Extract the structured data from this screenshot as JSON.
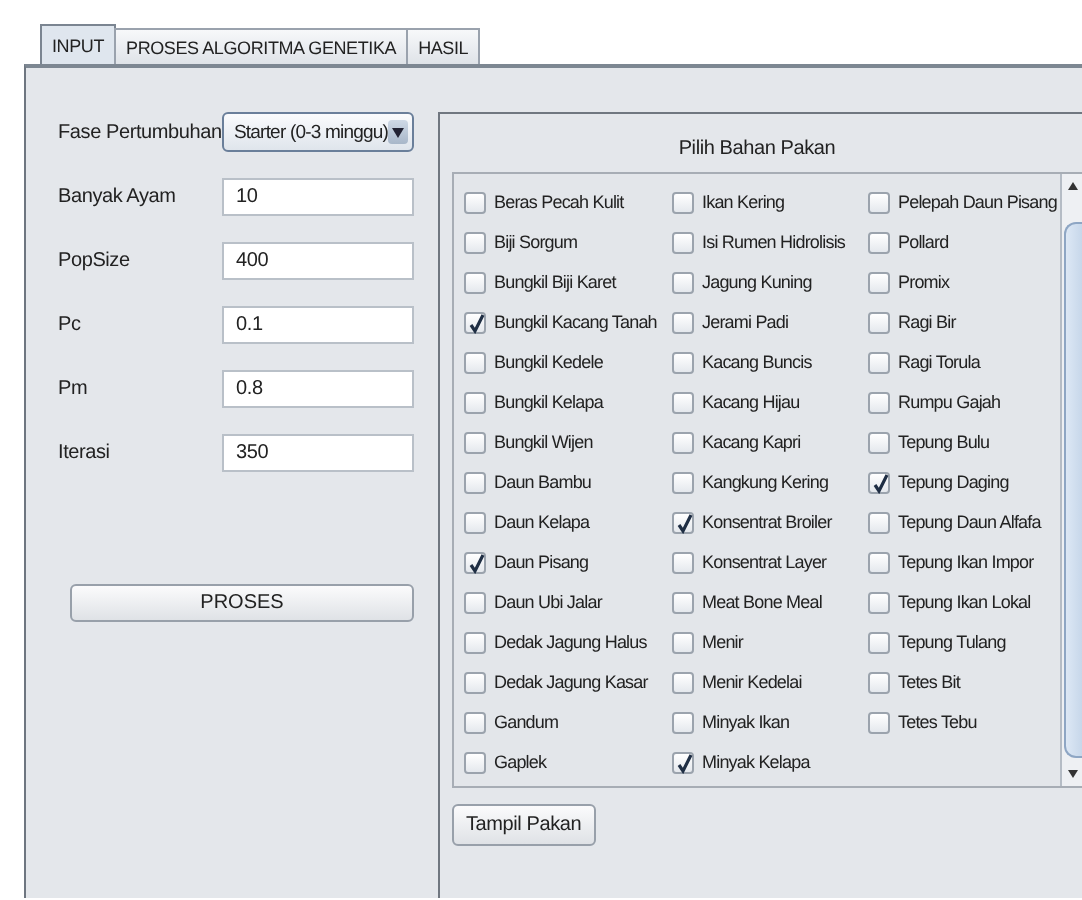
{
  "tabs": [
    {
      "label": "INPUT",
      "selected": true
    },
    {
      "label": "PROSES ALGORITMA GENETIKA",
      "selected": false
    },
    {
      "label": "HASIL",
      "selected": false
    }
  ],
  "form": {
    "fields": [
      {
        "kind": "combo",
        "label": "Fase Pertumbuhan",
        "value": "Starter  (0-3 minggu)"
      },
      {
        "kind": "text",
        "label": "Banyak Ayam",
        "value": "10"
      },
      {
        "kind": "text",
        "label": "PopSize",
        "value": "400"
      },
      {
        "kind": "text",
        "label": "Pc",
        "value": "0.1"
      },
      {
        "kind": "text",
        "label": "Pm",
        "value": "0.8"
      },
      {
        "kind": "text",
        "label": "Iterasi",
        "value": "350"
      }
    ],
    "button": "PROSES"
  },
  "feed": {
    "title": "Pilih Bahan Pakan",
    "columns": [
      [
        {
          "label": "Beras Pecah Kulit",
          "checked": false
        },
        {
          "label": "Biji Sorgum",
          "checked": false
        },
        {
          "label": "Bungkil Biji Karet",
          "checked": false
        },
        {
          "label": "Bungkil Kacang Tanah",
          "checked": true
        },
        {
          "label": "Bungkil Kedele",
          "checked": false
        },
        {
          "label": "Bungkil Kelapa",
          "checked": false
        },
        {
          "label": "Bungkil Wijen",
          "checked": false
        },
        {
          "label": "Daun Bambu",
          "checked": false
        },
        {
          "label": "Daun Kelapa",
          "checked": false
        },
        {
          "label": "Daun Pisang",
          "checked": true
        },
        {
          "label": "Daun Ubi Jalar",
          "checked": false
        },
        {
          "label": "Dedak Jagung Halus",
          "checked": false
        },
        {
          "label": "Dedak Jagung Kasar",
          "checked": false
        },
        {
          "label": "Gandum",
          "checked": false
        },
        {
          "label": "Gaplek",
          "checked": false
        }
      ],
      [
        {
          "label": "Ikan Kering",
          "checked": false
        },
        {
          "label": "Isi Rumen Hidrolisis",
          "checked": false
        },
        {
          "label": "Jagung Kuning",
          "checked": false
        },
        {
          "label": "Jerami Padi",
          "checked": false
        },
        {
          "label": "Kacang Buncis",
          "checked": false
        },
        {
          "label": "Kacang Hijau",
          "checked": false
        },
        {
          "label": "Kacang Kapri",
          "checked": false
        },
        {
          "label": "Kangkung Kering",
          "checked": false
        },
        {
          "label": "Konsentrat Broiler",
          "checked": true
        },
        {
          "label": "Konsentrat Layer",
          "checked": false
        },
        {
          "label": "Meat Bone Meal",
          "checked": false
        },
        {
          "label": "Menir",
          "checked": false
        },
        {
          "label": "Menir Kedelai",
          "checked": false
        },
        {
          "label": "Minyak Ikan",
          "checked": false
        },
        {
          "label": "Minyak Kelapa",
          "checked": true
        }
      ],
      [
        {
          "label": "Pelepah Daun Pisang",
          "checked": false
        },
        {
          "label": "Pollard",
          "checked": false
        },
        {
          "label": "Promix",
          "checked": false
        },
        {
          "label": "Ragi Bir",
          "checked": false
        },
        {
          "label": "Ragi Torula",
          "checked": false
        },
        {
          "label": "Rumpu Gajah",
          "checked": false
        },
        {
          "label": "Tepung Bulu",
          "checked": false
        },
        {
          "label": "Tepung Daging",
          "checked": true
        },
        {
          "label": "Tepung Daun Alfafa",
          "checked": false
        },
        {
          "label": "Tepung Ikan Impor",
          "checked": false
        },
        {
          "label": "Tepung Ikan Lokal",
          "checked": false
        },
        {
          "label": "Tepung Tulang",
          "checked": false
        },
        {
          "label": "Tetes Bit",
          "checked": false
        },
        {
          "label": "Tetes Tebu",
          "checked": false
        }
      ]
    ],
    "button": "Tampil Pakan"
  }
}
